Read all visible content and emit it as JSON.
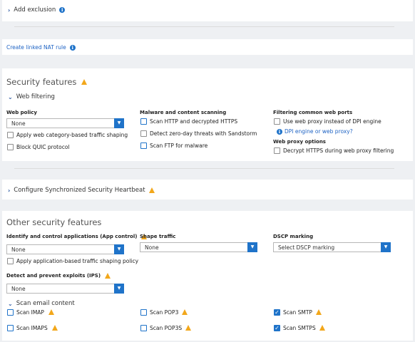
{
  "add_exclusion": {
    "label": "Add exclusion",
    "icon": "info-icon"
  },
  "nat": {
    "link": "Create linked NAT rule",
    "icon": "info-icon"
  },
  "security_features": {
    "title": "Security features",
    "web_filtering": {
      "label": "Web filtering",
      "web_policy": {
        "label": "Web policy",
        "value": "None"
      },
      "apply_category_shaping": "Apply web category-based traffic shaping",
      "block_quic": "Block QUIC protocol",
      "malware": {
        "heading": "Malware and content scanning",
        "scan_http": "Scan HTTP and decrypted HTTPS",
        "zero_day": "Detect zero-day threats with Sandstorm",
        "scan_ftp": "Scan FTP for malware"
      },
      "filtering_ports": {
        "heading": "Filtering common web ports",
        "use_proxy": "Use web proxy instead of DPI engine",
        "dpi_link": "DPI engine or web proxy?"
      },
      "proxy_options": {
        "heading": "Web proxy options",
        "decrypt_https": "Decrypt HTTPS during web proxy filtering"
      }
    }
  },
  "heartbeat": {
    "label": "Configure Synchronized Security Heartbeat"
  },
  "other": {
    "title": "Other security features",
    "app_control": {
      "label": "Identify and control applications (App control)",
      "value": "None"
    },
    "shape_traffic": {
      "label": "Shape traffic",
      "value": "None"
    },
    "dscp": {
      "label": "DSCP marking",
      "placeholder": "Select DSCP marking"
    },
    "apply_app_shaping": "Apply application-based traffic shaping policy",
    "ips": {
      "label": "Detect and prevent exploits (IPS)",
      "value": "None"
    },
    "scan_email": {
      "label": "Scan email content",
      "items": [
        {
          "label": "Scan IMAP",
          "checked": false
        },
        {
          "label": "Scan IMAPS",
          "checked": false
        },
        {
          "label": "Scan POP3",
          "checked": false
        },
        {
          "label": "Scan POP3S",
          "checked": false
        },
        {
          "label": "Scan SMTP",
          "checked": true
        },
        {
          "label": "Scan SMTPS",
          "checked": true
        }
      ]
    }
  },
  "colors": {
    "accent": "#1f73c9",
    "warning": "#f2a71b",
    "link": "#1e63c4"
  }
}
